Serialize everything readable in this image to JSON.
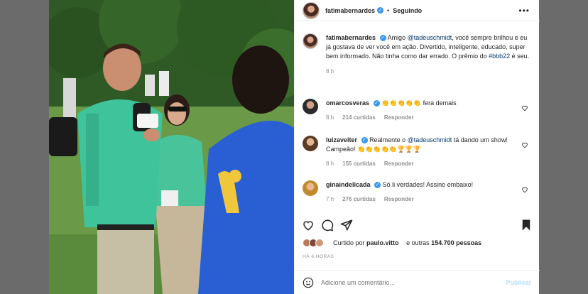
{
  "post": {
    "username": "fatimabernardes",
    "follow_label": "Seguindo",
    "caption": "Amigo @tadeuschmidt, você sempre brilhou e eu já gostava de ver você em ação. Divertido, inteligente, educado, super bem informado. Não tinha como dar errado. O prêmio do #bbb22 é seu.",
    "caption_time": "8 h",
    "liked_by_prefix": "Curtido por",
    "liked_by_user": "paulo.vitto",
    "liked_by_suffix": "e outras",
    "liked_by_count": "154.700 pessoas",
    "post_time": "HÁ 6 HORAS",
    "comment_placeholder": "Adicione um comentário...",
    "publish_label": "Publicar",
    "photo_badge": "GLOBO"
  },
  "comments": [
    {
      "user": "omarcosveras",
      "text": "👏👏👏👏👏 fera demais",
      "time": "8 h",
      "likes": "214 curtidas",
      "reply": "Responder"
    },
    {
      "user": "luizaveiter",
      "text": "Realmente o @tadeuschmidt tá dando um show! Campeão! 👏👏👏👏👏🏆🏆🏆",
      "time": "8 h",
      "likes": "155 curtidas",
      "reply": "Responder"
    },
    {
      "user": "ginaindelicada",
      "text": "Só li verdades! Assino embaixo!",
      "time": "7 h",
      "likes": "276 curtidas",
      "reply": "Responder"
    }
  ],
  "icons": [
    "heart-icon",
    "comment-icon",
    "share-icon",
    "bookmark-icon",
    "emoji-icon",
    "more-icon"
  ],
  "colors": {
    "link": "#00376b",
    "verified": "#3897f0",
    "publish": "#b2dffc"
  }
}
